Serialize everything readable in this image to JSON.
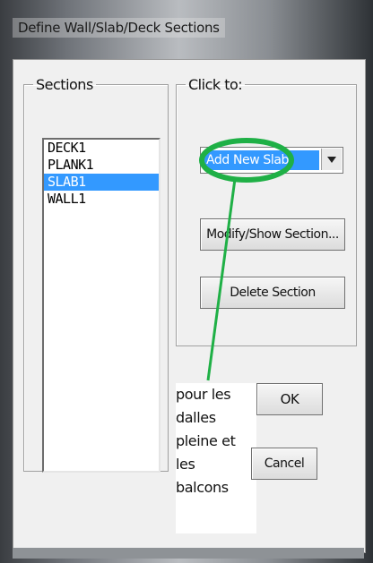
{
  "window": {
    "title": "Define Wall/Slab/Deck Sections"
  },
  "sections": {
    "legend": "Sections",
    "items": [
      "DECK1",
      "PLANK1",
      "SLAB1",
      "WALL1"
    ],
    "selected_index": 2
  },
  "click_to": {
    "legend": "Click to:",
    "dropdown_value": "Add New Slab",
    "modify_label": "Modify/Show Section...",
    "delete_label": "Delete Section"
  },
  "buttons": {
    "ok": "OK",
    "cancel": "Cancel"
  },
  "annotation": {
    "lines": [
      "pour les",
      "dalles",
      "pleine et les",
      "balcons"
    ],
    "color": "#1fb046"
  },
  "colors": {
    "selection": "#3399ff",
    "annotation": "#1fb046"
  },
  "icons": {
    "dropdown": "chevron-down-icon"
  }
}
